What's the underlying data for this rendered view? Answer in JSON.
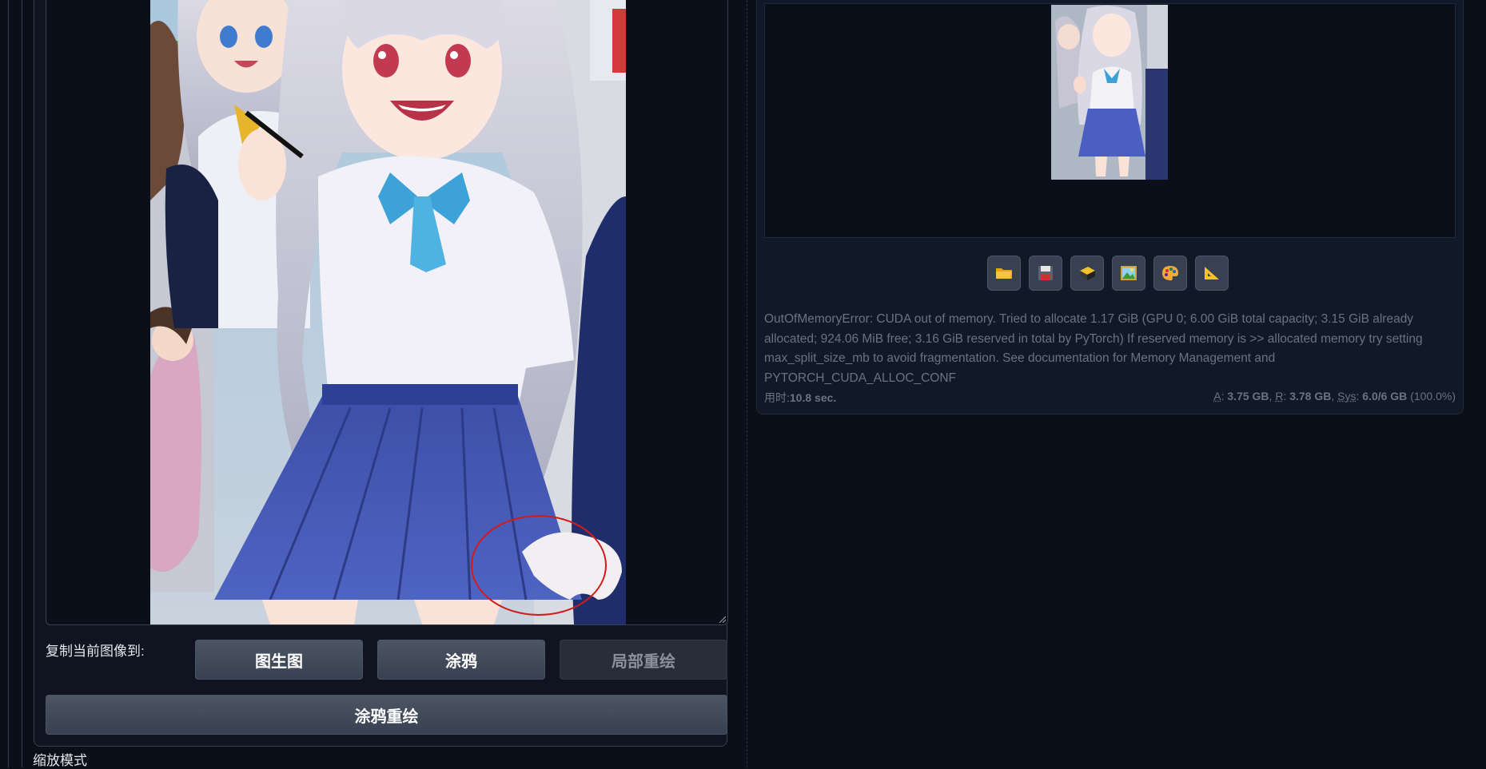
{
  "copy_to": {
    "label": "复制当前图像到:",
    "buttons": [
      "图生图",
      "涂鸦",
      "局部重绘"
    ]
  },
  "sketch_inpaint_button": "涂鸦重绘",
  "scale_mode_label": "缩放模式",
  "toolbar_icons": [
    "folder-icon",
    "save-icon",
    "zip-icon",
    "image-icon",
    "palette-icon",
    "ruler-icon"
  ],
  "error_message": "OutOfMemoryError: CUDA out of memory. Tried to allocate 1.17 GiB (GPU 0; 6.00 GiB total capacity; 3.15 GiB already allocated; 924.06 MiB free; 3.16 GiB reserved in total by PyTorch) If reserved memory is >> allocated memory try setting max_split_size_mb to avoid fragmentation. See documentation for Memory Management and PYTORCH_CUDA_ALLOC_CONF",
  "timing": {
    "label": "用时:",
    "value": "10.8 sec."
  },
  "memory": {
    "a_label": "A",
    "a_value": "3.75 GB",
    "r_label": "R",
    "r_value": "3.78 GB",
    "sys_label": "Sys",
    "sys_value": "6.0/6 GB",
    "sys_percent": "(100.0%)"
  },
  "colors": {
    "background": "#0b0f19",
    "panel": "#111827",
    "button": "#4b5563",
    "mask_circle": "#d01c1c"
  }
}
